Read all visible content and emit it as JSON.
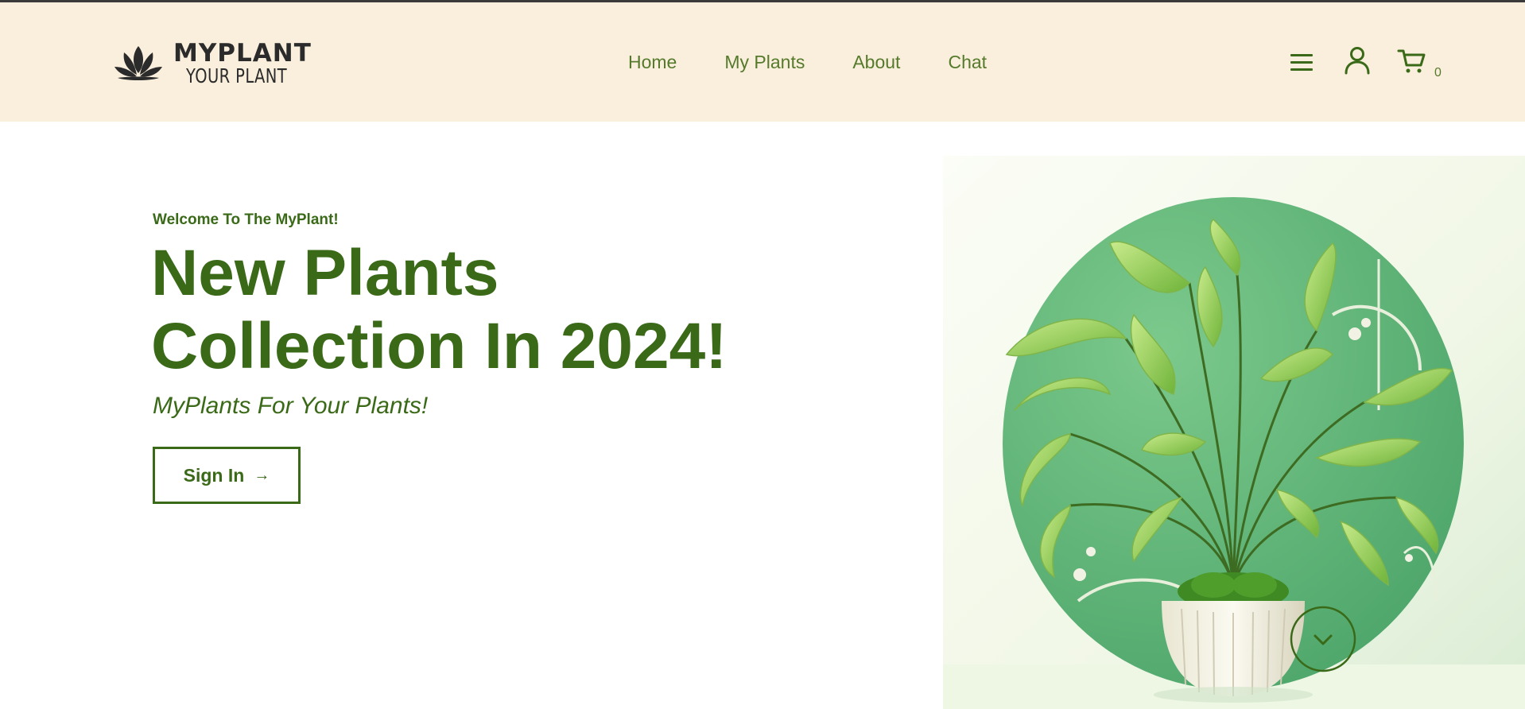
{
  "header": {
    "logo": {
      "title": "MYPLANT",
      "subtitle": "YOUR PLANT",
      "icon": "lotus-icon"
    },
    "nav": [
      "Home",
      "My Plants",
      "About",
      "Chat"
    ],
    "icons": [
      "menu-icon",
      "user-icon",
      "cart-icon"
    ],
    "cart_count": "0"
  },
  "hero": {
    "eyebrow": "Welcome To The MyPlant!",
    "title_line1": "New Plants",
    "title_line2": "Collection In 2024!",
    "subtitle": "MyPlants For Your Plants!",
    "button_label": "Sign In",
    "button_icon": "arrow-right-icon",
    "scroll_icon": "chevron-down-icon"
  },
  "colors": {
    "header_bg": "#faefdc",
    "accent_green": "#3a6a18",
    "nav_green": "#557a2b"
  }
}
